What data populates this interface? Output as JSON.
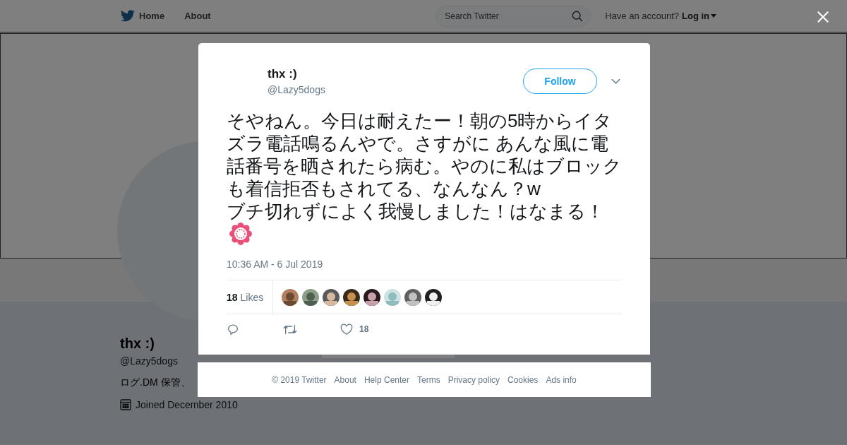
{
  "top_bar": {
    "nav": [
      {
        "label": "Home"
      },
      {
        "label": "About"
      }
    ],
    "search": {
      "placeholder": "Search Twitter"
    },
    "account_prompt": "Have an account?",
    "login": "Log in"
  },
  "profile": {
    "name": "thx :)",
    "handle": "@Lazy5dogs",
    "bio": "ログ.DM 保管、",
    "joined": "Joined December 2010"
  },
  "tweet": {
    "name": "thx :)",
    "handle": "@Lazy5dogs",
    "follow": "Follow",
    "text": "そやねん。今日は耐えたー！朝の5時からイタズラ電話鳴るんやで。さすがに あんな風に電話番号を晒されたら病む。やのに私はブロックも着信拒否もされてる、なんなん？w\nブチ切れずによく我慢しました！はなまる！",
    "timestamp": "10:36 AM - 6 Jul 2019",
    "likes_count": "18",
    "likes_label": "Likes",
    "like_action_count": "18"
  },
  "footer": [
    "© 2019 Twitter",
    "About",
    "Help Center",
    "Terms",
    "Privacy policy",
    "Cookies",
    "Ads info"
  ]
}
